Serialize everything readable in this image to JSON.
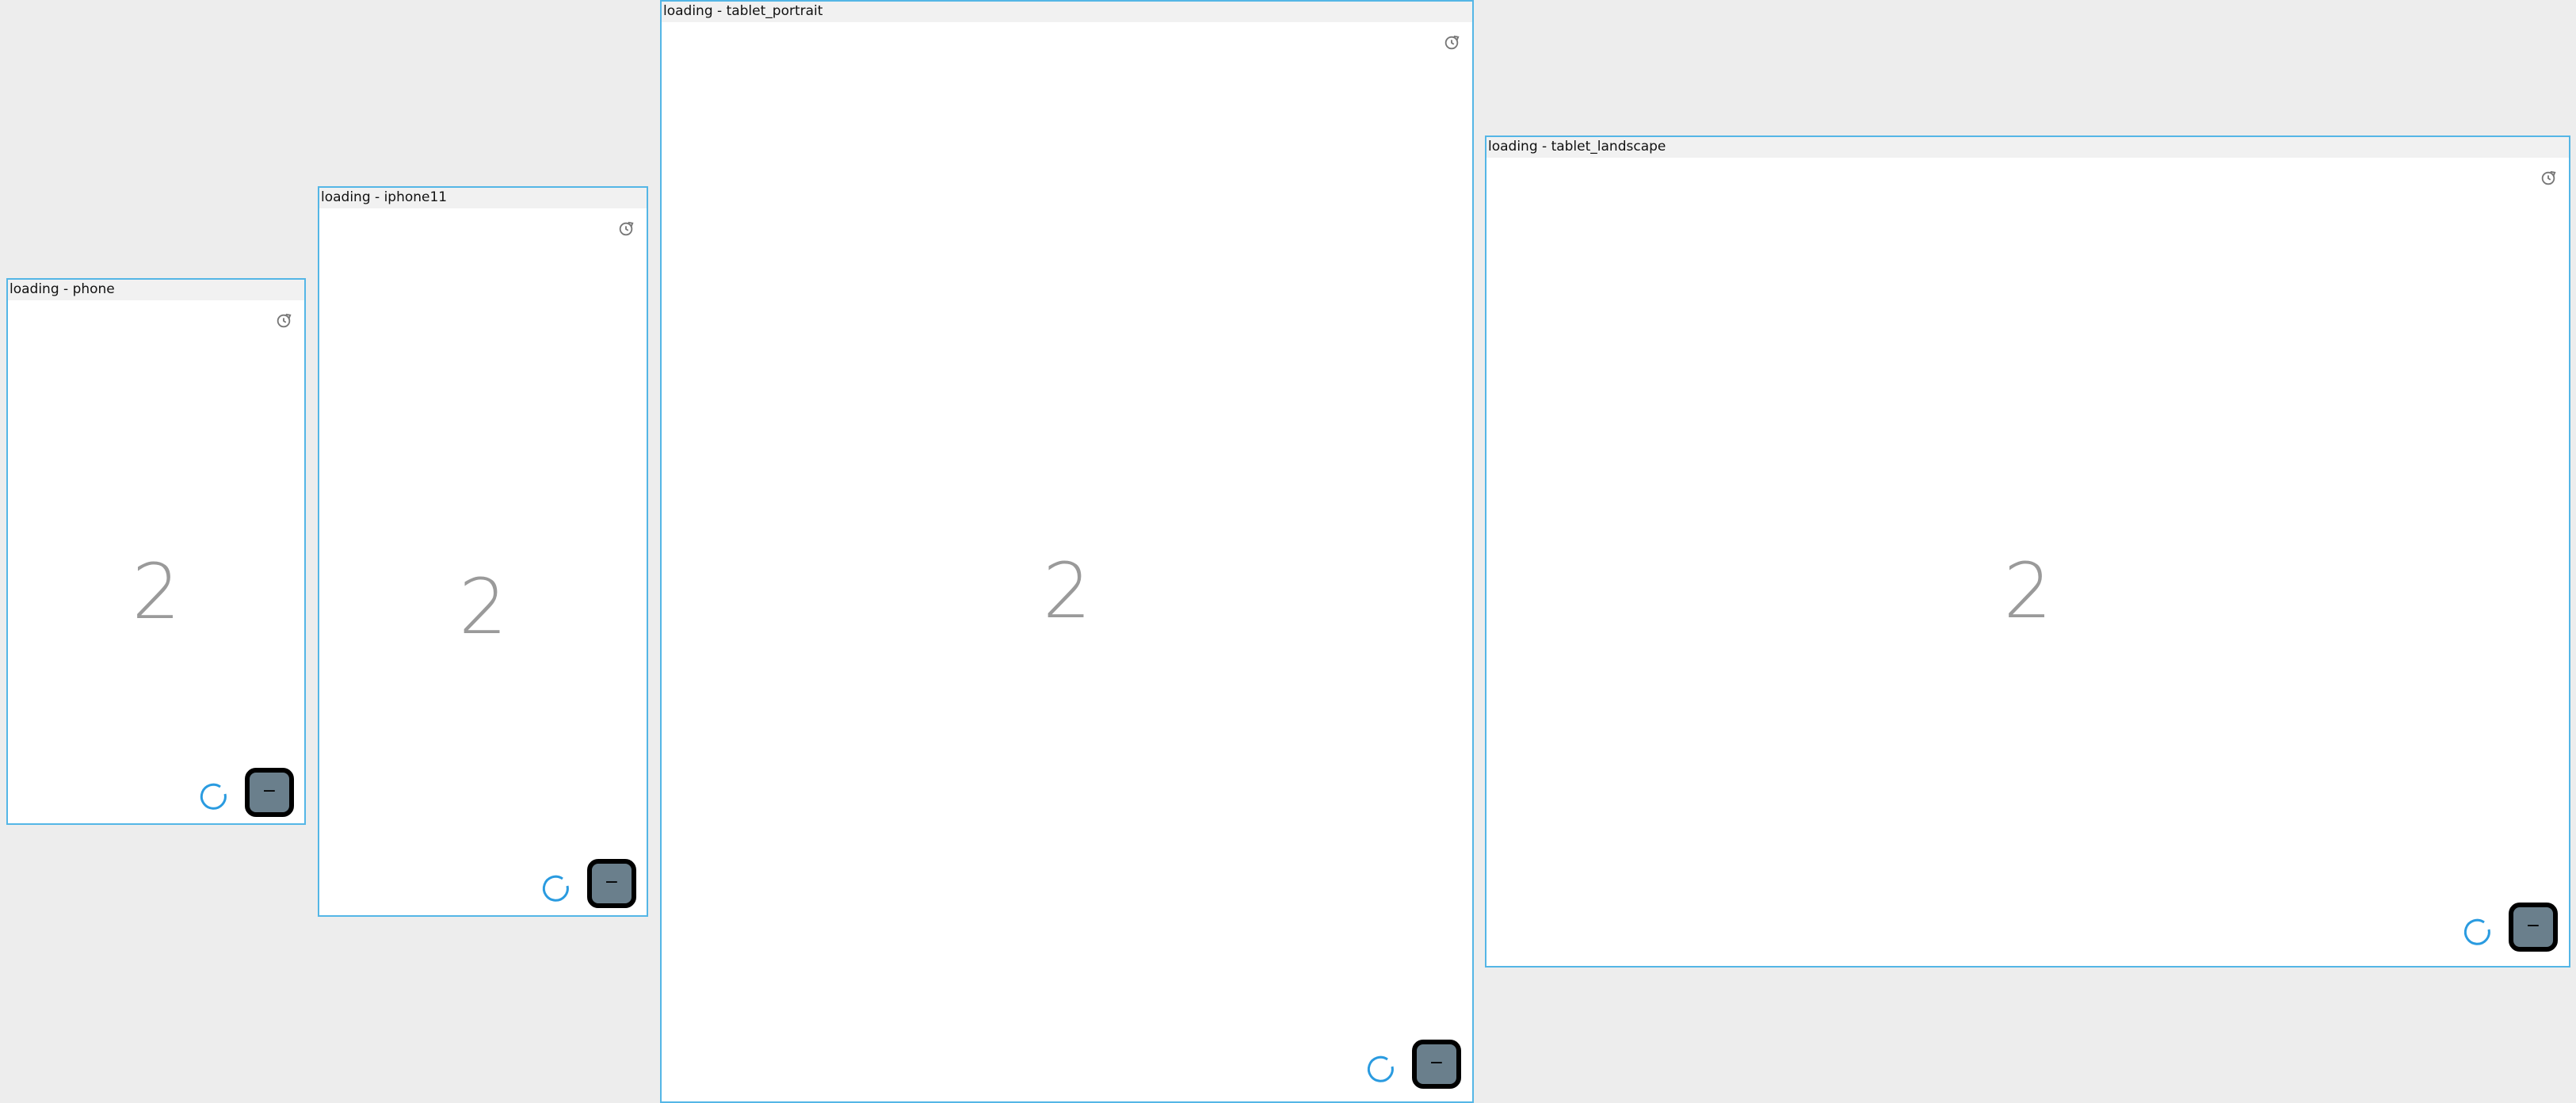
{
  "frames": [
    {
      "title": "loading - phone",
      "digit": "2",
      "fab_label": "−"
    },
    {
      "title": "loading - iphone11",
      "digit": "2",
      "fab_label": "−"
    },
    {
      "title": "loading - tablet_portrait",
      "digit": "2",
      "fab_label": "−"
    },
    {
      "title": "loading - tablet_landscape",
      "digit": "2",
      "fab_label": "−"
    }
  ],
  "icons": {
    "refresh": "refresh-icon",
    "spinner": "loading-spinner-icon"
  },
  "colors": {
    "frame_border": "#54b6e6",
    "spinner": "#2a9be0",
    "fab_fill": "#6a7f8c",
    "digit": "#9a9a9a",
    "canvas": "#ededed"
  }
}
